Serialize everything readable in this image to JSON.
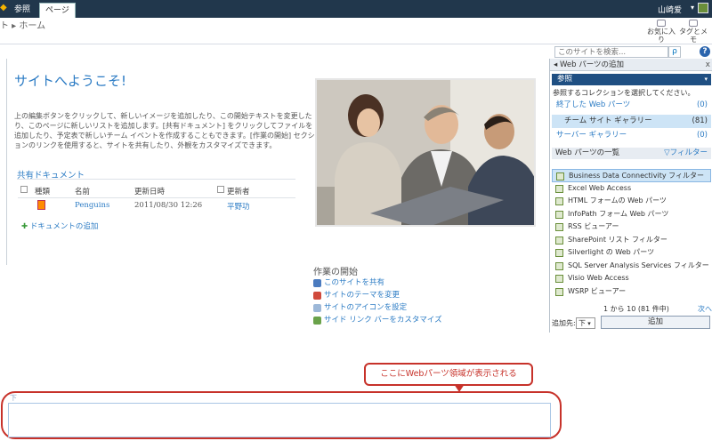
{
  "ribbon": {
    "tabs": [
      {
        "label": "参照"
      },
      {
        "label": "ページ"
      }
    ],
    "user": "山崎爱",
    "user_dropdown": "▾"
  },
  "header": {
    "breadcrumb": "ト ▸ ホーム",
    "like_label_1": "お気に入",
    "like_label_2": "り",
    "tag_label_1": "タグとメ",
    "tag_label_2": "モ"
  },
  "search": {
    "placeholder": "このサイトを検索...",
    "button": "ρ",
    "help": "?"
  },
  "main": {
    "title": "サイトへようこそ!",
    "intro": "上の編集ボタンをクリックして、新しいイメージを追加したり、この開始テキストを変更したり、このページに新しいリストを追加します。[共有ドキュメント] をクリックしてファイルを追加したり、予定表で新しいチーム イベントを作成することもできます。[作業の開始] セクションのリンクを使用すると、サイトを共有したり、外観をカスタマイズできます。",
    "shared_docs_title": "共有ドキュメント",
    "columns": {
      "type": "種類",
      "name": "名前",
      "modified": "更新日時",
      "modified_by": "更新者"
    },
    "rows": [
      {
        "name": "Penguins",
        "modified": "2011/08/30 12:26",
        "modified_by": "平野功"
      }
    ],
    "add_document": "ドキュメントの追加"
  },
  "getting_started": {
    "title": "作業の開始",
    "items": [
      {
        "label": "このサイトを共有"
      },
      {
        "label": "サイトのテーマを変更"
      },
      {
        "label": "サイトのアイコンを設定"
      },
      {
        "label": "サイド リンク バーをカスタマイズ"
      }
    ]
  },
  "callout": {
    "text": "ここにWebパーツ領域が表示される"
  },
  "zone": {
    "label": "下"
  },
  "panel": {
    "title": "Web パーツの追加",
    "close": "x",
    "browse": "参照",
    "note": "参照するコレクションを選択してください。",
    "galleries": [
      {
        "name": "終了した Web パーツ",
        "count": "(0)"
      },
      {
        "name": "チーム サイト ギャラリー",
        "count": "(81)"
      },
      {
        "name": "サーバー ギャラリー",
        "count": "(0)"
      }
    ],
    "list_title": "Web パーツの一覧",
    "filter": "フィルター",
    "web_parts": [
      {
        "label": "Business Data Connectivity フィルター"
      },
      {
        "label": "Excel Web Access"
      },
      {
        "label": "HTML フォームの Web パーツ"
      },
      {
        "label": "InfoPath フォーム Web パーツ"
      },
      {
        "label": "RSS ビューアー"
      },
      {
        "label": "SharePoint リスト フィルター"
      },
      {
        "label": "Silverlight の Web パーツ"
      },
      {
        "label": "SQL Server Analysis Services フィルター"
      },
      {
        "label": "Visio Web Access"
      },
      {
        "label": "WSRP ビューアー"
      }
    ],
    "pager": "1 から 10 (81 件中)",
    "next": "次へ",
    "add_to_label": "追加先:",
    "add_to_value": "下",
    "add_button": "追加"
  },
  "colors": {
    "ribbon": "#21374c",
    "link": "#2b7bc4",
    "callout": "#c7322a",
    "selection": "#cde4f6"
  }
}
